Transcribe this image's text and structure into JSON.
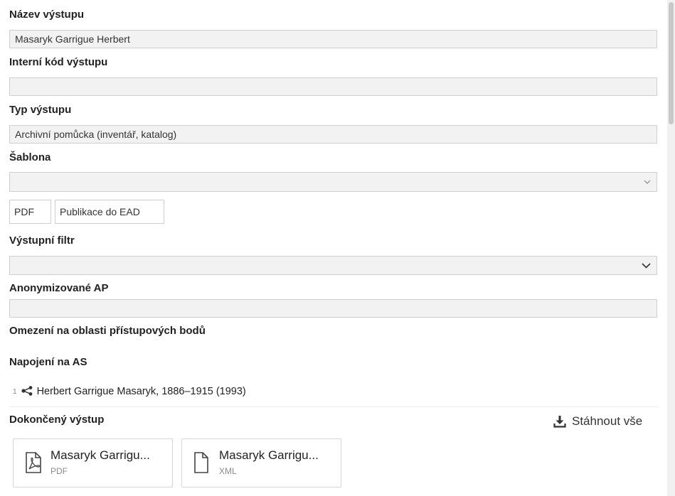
{
  "form": {
    "output_name": {
      "label": "Název výstupu",
      "value": "Masaryk Garrigue Herbert"
    },
    "internal_code": {
      "label": "Interní kód výstupu",
      "value": ""
    },
    "output_type": {
      "label": "Typ výstupu",
      "value": "Archivní pomůcka (inventář, katalog)"
    },
    "template": {
      "label": "Šablona",
      "value": "",
      "icon": "chevron-down-icon"
    },
    "action_buttons": {
      "pdf": "PDF",
      "publish_ead": "Publikace do EAD"
    },
    "output_filter": {
      "label": "Výstupní filtr",
      "value": "",
      "icon": "chevron-down-icon"
    },
    "anonymized_ap": {
      "label": "Anonymizované AP",
      "value": ""
    },
    "access_points_restriction": {
      "label": "Omezení na oblasti přístupových bodů"
    },
    "as_link": {
      "label": "Napojení na AS",
      "items": [
        {
          "index": "1",
          "icon": "hierarchy-icon",
          "text": "Herbert Garrigue Masaryk, 1886–1915 (1993)"
        }
      ]
    }
  },
  "finished_output": {
    "label": "Dokončený výstup",
    "download_all": "Stáhnout vše",
    "download_icon": "download-icon",
    "files": [
      {
        "name": "Masaryk Garrigu...",
        "type": "PDF",
        "icon": "pdf-file-icon"
      },
      {
        "name": "Masaryk Garrigu...",
        "type": "XML",
        "icon": "file-icon"
      }
    ]
  },
  "colors": {
    "field_bg": "#f2f2f2",
    "field_border": "#cfcfcf",
    "text": "#222222",
    "muted": "#8a8a8a"
  }
}
